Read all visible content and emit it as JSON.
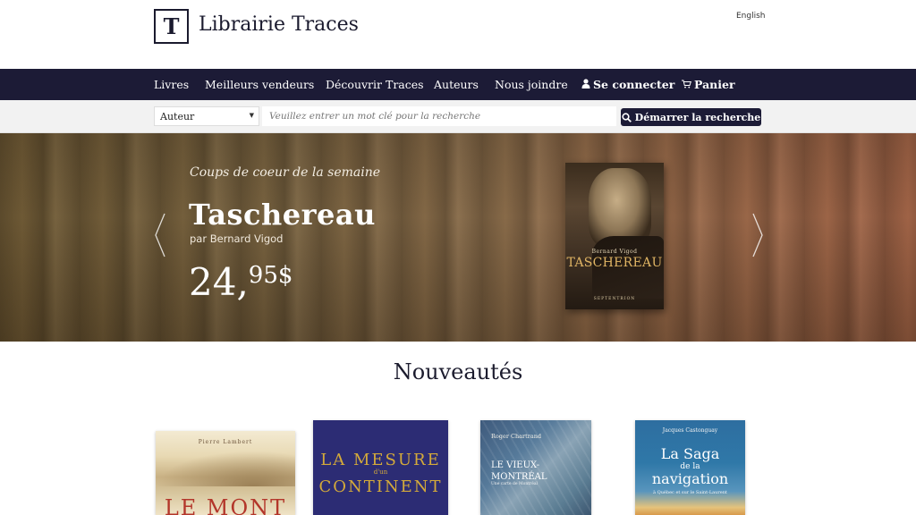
{
  "header": {
    "logo_letter": "T",
    "site_name": "Librairie Traces",
    "language_link": "English"
  },
  "nav": {
    "items": [
      {
        "label": "Livres"
      },
      {
        "label": "Meilleurs vendeurs"
      },
      {
        "label": "Découvrir Traces"
      },
      {
        "label": "Auteurs"
      },
      {
        "label": "Nous joindre"
      }
    ],
    "login_label": "Se connecter",
    "login_icon": "user-icon",
    "cart_label": "Panier",
    "cart_icon": "cart-icon"
  },
  "search": {
    "filter_selected": "Auteur",
    "placeholder": "Veuillez entrer un mot clé pour la recherche",
    "button_label": "Démarrer la recherche",
    "button_icon": "search-icon"
  },
  "hero": {
    "eyebrow": "Coups de coeur de la semaine",
    "title": "Taschereau",
    "author": "par Bernard Vigod",
    "price_main": "24,",
    "price_cents": "95$",
    "book": {
      "author": "Bernard Vigod",
      "title": "TASCHEREAU",
      "publisher": "SEPTENTRION"
    }
  },
  "new_releases": {
    "title": "Nouveautés",
    "covers": [
      {
        "author": "Pierre Lambert",
        "title": "LE MONT"
      },
      {
        "title_1": "LA MESURE",
        "title_2": "d'un",
        "title_3": "CONTINENT"
      },
      {
        "author": "Roger Chartrand",
        "title": "LE VIEUX-MONTRÉAL",
        "subtitle": "Une carte de Montréal"
      },
      {
        "author": "Jacques Castonguay",
        "title_1": "La Saga",
        "title_2": "de la",
        "title_3": "navigation",
        "subtitle": "à Québec et sur le Saint-Laurent"
      }
    ]
  },
  "colors": {
    "navy": "#1c1b36",
    "hero_gold": "#e0b564"
  }
}
